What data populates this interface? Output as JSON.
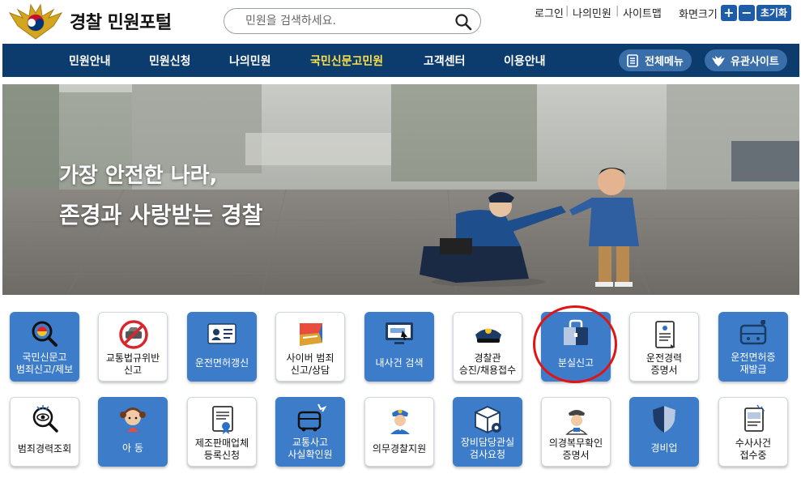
{
  "header": {
    "site_title": "경찰 민원포털",
    "search": {
      "placeholder": "민원을 검색하세요.",
      "value": ""
    },
    "util_links": [
      "로그인",
      "나의민원",
      "사이트맵"
    ],
    "font_size": {
      "label": "화면크기",
      "plus": "+",
      "minus": "−",
      "reset": "초기화"
    }
  },
  "nav": {
    "items": [
      {
        "label": "민원안내",
        "active": false
      },
      {
        "label": "민원신청",
        "active": false
      },
      {
        "label": "나의민원",
        "active": false
      },
      {
        "label": "국민신문고민원",
        "active": true
      },
      {
        "label": "고객센터",
        "active": false
      },
      {
        "label": "이용안내",
        "active": false
      }
    ],
    "all_menu": "전체메뉴",
    "related_sites": "유관사이트"
  },
  "banner": {
    "line1": "가장 안전한 나라,",
    "line2": "존경과 사랑받는 경찰"
  },
  "tiles_row1": [
    {
      "line1": "국민신문고",
      "line2": "범죄신고/제보",
      "style": "blue",
      "icon": "shield-search-icon"
    },
    {
      "line1": "교통법규위반",
      "line2": "신고",
      "style": "white",
      "icon": "no-car-icon"
    },
    {
      "line1": "운전면허갱신",
      "line2": "",
      "style": "blue",
      "icon": "license-card-icon"
    },
    {
      "line1": "사이버 범죄",
      "line2": "신고/상담",
      "style": "white",
      "icon": "cyber-flag-icon"
    },
    {
      "line1": "내사건 검색",
      "line2": "",
      "style": "blue",
      "icon": "monitor-search-icon"
    },
    {
      "line1": "경찰관",
      "line2": "승진/채용접수",
      "style": "white",
      "icon": "police-cap-icon"
    },
    {
      "line1": "분실신고",
      "line2": "",
      "style": "blue",
      "icon": "lost-bag-icon"
    },
    {
      "line1": "운전경력",
      "line2": "증명서",
      "style": "white",
      "icon": "document-scroll-icon"
    },
    {
      "line1": "운전면허증",
      "line2": "재발급",
      "style": "blue",
      "icon": "license-reissue-icon"
    }
  ],
  "tiles_row2": [
    {
      "line1": "범죄경력조회",
      "line2": "",
      "style": "white",
      "icon": "eye-search-icon"
    },
    {
      "line1": "아 동",
      "line2": "",
      "style": "blue",
      "icon": "child-icon"
    },
    {
      "line1": "제조판매업체",
      "line2": "등록신청",
      "style": "white",
      "icon": "certificate-icon"
    },
    {
      "line1": "교통사고",
      "line2": "사실확인원",
      "style": "blue",
      "icon": "bus-accident-icon"
    },
    {
      "line1": "의무경찰지원",
      "line2": "",
      "style": "white",
      "icon": "police-officer-icon"
    },
    {
      "line1": "장비담당관실",
      "line2": "검사요청",
      "style": "blue",
      "icon": "equipment-box-icon"
    },
    {
      "line1": "의경복무확인",
      "line2": "증명서",
      "style": "white",
      "icon": "officer-badge-icon"
    },
    {
      "line1": "경비업",
      "line2": "",
      "style": "blue",
      "icon": "security-shield-icon"
    },
    {
      "line1": "수사사건",
      "line2": "접수중",
      "style": "white",
      "icon": "case-document-icon"
    }
  ],
  "colors": {
    "nav_bg": "#0c3b6d",
    "nav_active": "#f8e04a",
    "tile_blue": "#3d7cc9",
    "accent_blue": "#1f5ca8",
    "highlight_red": "#e01414"
  }
}
